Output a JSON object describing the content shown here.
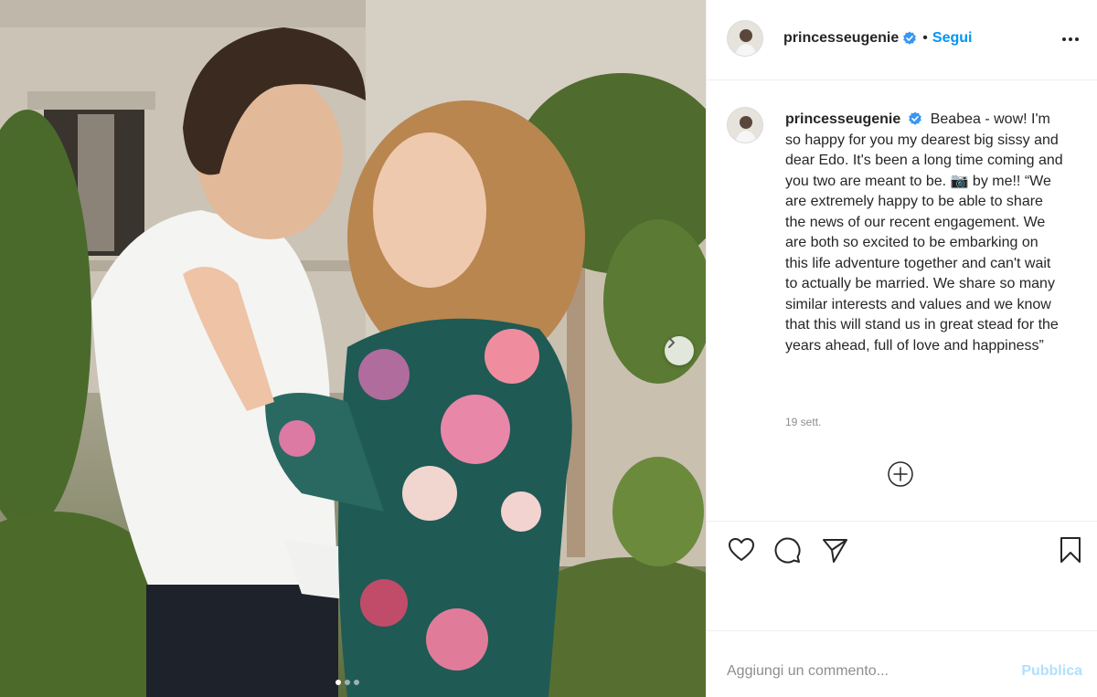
{
  "post": {
    "username": "princesseugenie",
    "follow_label": "Segui",
    "bullet": "•",
    "caption": "Beabea - wow! I'm so happy for you my dearest big sissy and dear Edo. It's been a long time coming and you two are meant to be. 📷 by me!! “We are extremely happy to be able to share the news of our recent engagement. We are both so excited to be embarking on this life adventure together and can't wait to actually be married. We share so many similar interests and values and we know that this will stand us in great stead for the years ahead, full of love and happiness”",
    "timestamp": "19 sett.",
    "carousel": {
      "total": 3,
      "current": 1
    }
  },
  "comment": {
    "placeholder": "Aggiungi un commento...",
    "publish_label": "Pubblica"
  },
  "colors": {
    "accent": "#0095f6",
    "publish_disabled": "#b2dffc",
    "verified": "#3897f0",
    "muted": "#8e8e8e"
  },
  "icons": [
    "more-options-icon",
    "heart-icon",
    "comment-icon",
    "share-icon",
    "bookmark-icon",
    "add-circle-icon",
    "chevron-right-icon",
    "verified-badge-icon"
  ]
}
